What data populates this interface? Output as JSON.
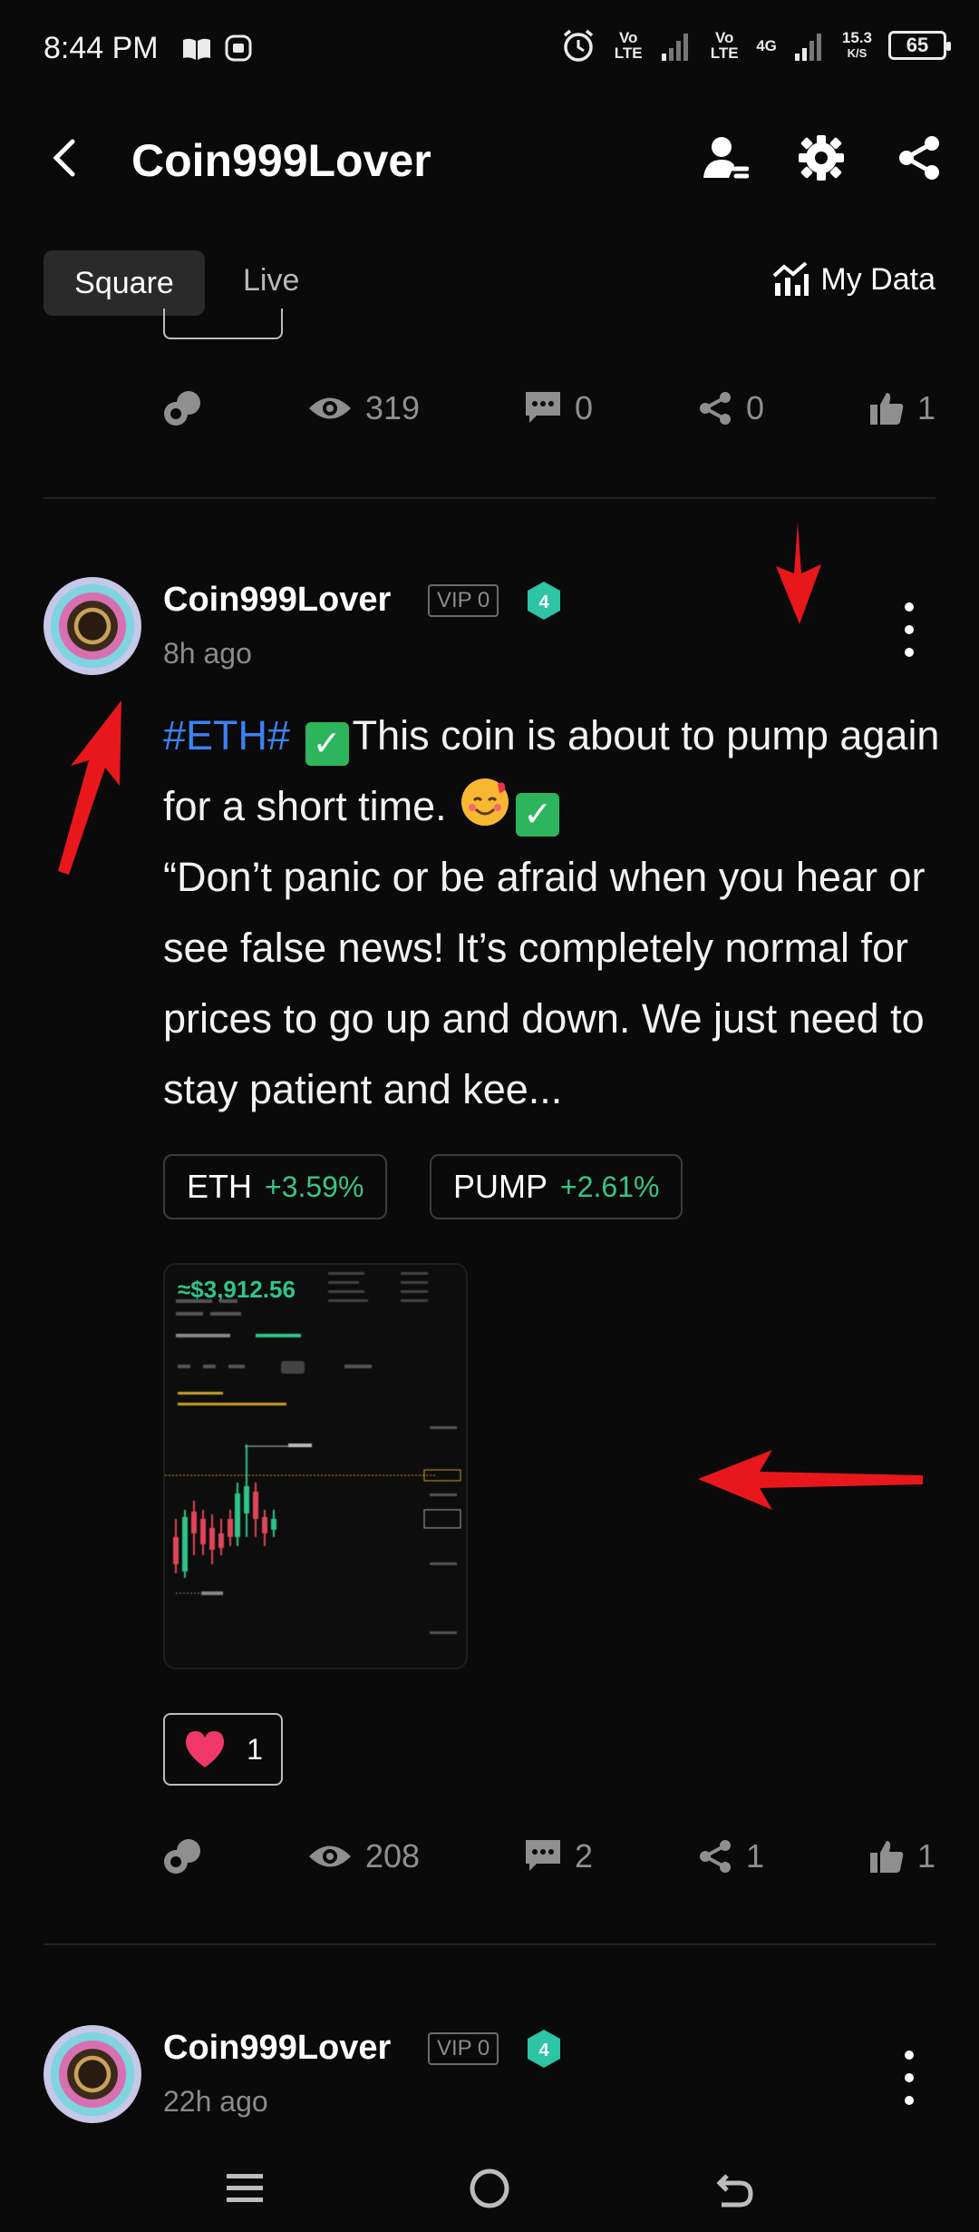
{
  "status_bar": {
    "time": "8:44 PM",
    "network_label_1": "Vo LTE",
    "network_label_2": "Vo LTE",
    "network_type": "4G",
    "speed_value": "15.3",
    "speed_unit": "K/S",
    "battery": "65",
    "icons": [
      "book-icon",
      "media-icon",
      "alarm-icon",
      "signal-icon",
      "signal-icon"
    ]
  },
  "header": {
    "title": "Coin999Lover",
    "icons": [
      "back-icon",
      "profile-icon",
      "settings-icon",
      "share-icon"
    ]
  },
  "tabs": [
    {
      "label": "Square",
      "active": true
    },
    {
      "label": "Live",
      "active": false
    }
  ],
  "my_data_label": "My Data",
  "prev_post_stats": {
    "views": "319",
    "comments": "0",
    "shares": "0",
    "likes": "1"
  },
  "post": {
    "username": "Coin999Lover",
    "vip": "VIP 0",
    "level": "4",
    "time": "8h ago",
    "hashtag": "#ETH#",
    "text_1": "This coin is about to pump again for a short time.",
    "text_2": "“Don’t panic or be afraid when you hear or see false news! It’s completely normal for prices to go up and down. We just need to stay patient and kee...",
    "chips": [
      {
        "name": "ETH",
        "change": "+3.59%"
      },
      {
        "name": "PUMP",
        "change": "+2.61%"
      }
    ],
    "thumbnail_price": "≈$3,912.56",
    "reaction_count": "1",
    "stats": {
      "views": "208",
      "comments": "2",
      "shares": "1",
      "likes": "1"
    }
  },
  "next_post": {
    "username": "Coin999Lover",
    "vip": "VIP 0",
    "level": "4",
    "time": "22h ago"
  },
  "nav_bar": {
    "icons": [
      "menu-icon",
      "home-icon",
      "back-nav-icon"
    ]
  },
  "colors": {
    "background": "#0a0a0a",
    "hashtag": "#3b82f6",
    "positive": "#3ac486",
    "level_badge": "#2ec4a6",
    "annotation_arrow": "#e8171b"
  }
}
